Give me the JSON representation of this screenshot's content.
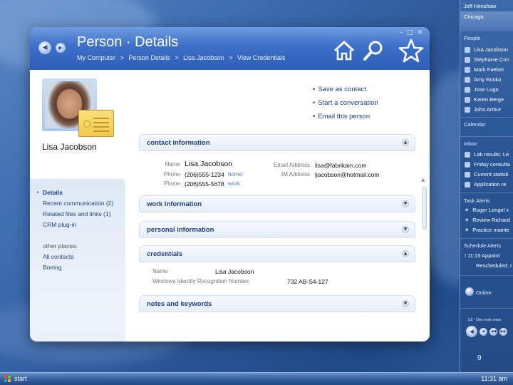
{
  "window": {
    "title": "Person · Details",
    "breadcrumb": [
      "My Computer",
      ">",
      "Person Details",
      ">",
      "Lisa Jacobson",
      ">",
      "View Credentials"
    ]
  },
  "toolbar_icons": [
    "home-icon",
    "search-icon",
    "star-icon"
  ],
  "person": {
    "name": "Lisa Jacobson"
  },
  "leftnav": {
    "items": [
      "Details",
      "Recent communication (2)",
      "Related files and links (1)",
      "CRM plug-in"
    ],
    "other_places_label": "other places:",
    "other_places": [
      "All contacts",
      "Boeing"
    ]
  },
  "actions": [
    "Save as contact",
    "Start a conversation",
    "Email this person"
  ],
  "sections": {
    "contact": {
      "title": "contact information",
      "name_label": "Name",
      "name_value": "Lisa Jacobson",
      "phone_label": "Phone",
      "phone1": "(206)555-1234",
      "phone1_tag": "home",
      "phone2": "(206)555-5678",
      "phone2_tag": "work",
      "email_label": "Email Address",
      "email_value": "lisa@fabrikam.com",
      "im_label": "IM Address",
      "im_value": "ljacobson@hotmail.com"
    },
    "work": {
      "title": "work information"
    },
    "personal": {
      "title": "personal information"
    },
    "credentials": {
      "title": "credentials",
      "name_label": "Name",
      "name_value": "Lisa Jacobson",
      "wirn_label": "Windows Identity Recognition Number",
      "wirn_value": "732 AB-S4-127"
    },
    "notes": {
      "title": "notes and keywords"
    }
  },
  "sidebar": {
    "user": "Jeff Henshaw",
    "city": "Chicago",
    "people_label": "People",
    "people": [
      "Lisa Jacobson",
      "Stephanie Con",
      "Mark Faeber",
      "Amy Rusko",
      "Jose Lugo",
      "Karen Berge",
      "John Arthur"
    ],
    "calendar_label": "Calendar",
    "inbox_label": "Inbox",
    "inbox": [
      "Lab results: Le",
      "Friday consulta",
      "Current statisti",
      "Application re"
    ],
    "task_label": "Task Alerts",
    "tasks": [
      "Roger Lengel x",
      "Review Richard",
      "Practice mainte"
    ],
    "schedule_label": "Schedule Alerts",
    "schedule": [
      "! 11:15 Appoint",
      "Rescheduled: r"
    ],
    "online": "Online",
    "media_track": "U2 - One more voice"
  },
  "slide_number": "9",
  "taskbar": {
    "start": "start",
    "clock": "11:31 am"
  },
  "colors": {
    "accent": "#2f5fb8",
    "link": "#1e3f8a",
    "tag": "#4a7fd1"
  }
}
